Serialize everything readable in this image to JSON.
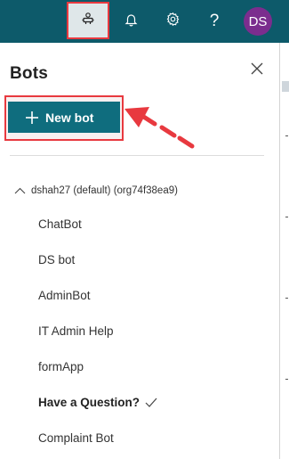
{
  "header": {
    "bot_icon": "bot-icon",
    "bell_icon": "bell-icon",
    "gear_icon": "gear-icon",
    "help_label": "?",
    "avatar_initials": "DS",
    "colors": {
      "bar": "#0d5a6a",
      "avatar": "#7b2d8e",
      "highlight": "#e8393f"
    }
  },
  "panel": {
    "title": "Bots",
    "close_icon": "close-icon",
    "new_bot_label": "New bot",
    "org_label": "dshah27 (default) (org74f38ea9)",
    "bots": [
      {
        "label": "ChatBot"
      },
      {
        "label": "DS bot"
      },
      {
        "label": "AdminBot"
      },
      {
        "label": "IT Admin Help"
      },
      {
        "label": "formApp"
      },
      {
        "label": "Have a Question?",
        "selected": true
      },
      {
        "label": "Complaint Bot"
      }
    ]
  }
}
